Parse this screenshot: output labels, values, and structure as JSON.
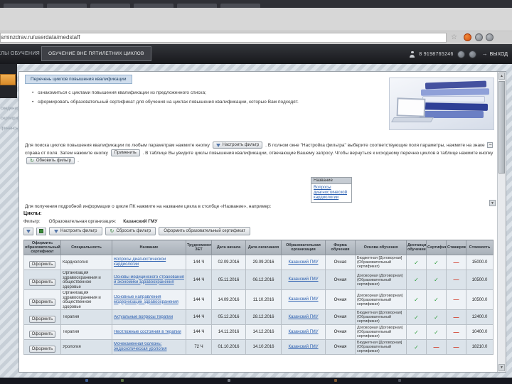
{
  "browser": {
    "url": "rosminzdrav.ru/userdata/medstaff"
  },
  "header": {
    "tab_cycles": "ЦИКЛЫ ОБУЧЕНИЯ",
    "tab_outside_cycles": "ОБУЧЕНИЕ ВНЕ ПЯТИЛЕТНИХ ЦИКЛОВ",
    "phone": "8 9198765246",
    "logout_label": "ВЫХОД"
  },
  "sidebar": {
    "items": [
      {
        "label": "сведения"
      },
      {
        "label": "сертификаты"
      },
      {
        "label": "финансы"
      }
    ]
  },
  "icons": {
    "star": "☆",
    "scroll_down": "▼",
    "scroll_up": "▲",
    "refresh": "↻",
    "logout_arrow": "→",
    "minus": "−"
  },
  "colors": {
    "accent_orange": "#d98a28",
    "link_blue": "#2b5fb0",
    "check_green": "#2e9e3a",
    "dash_red": "#d23c2a"
  },
  "content": {
    "section_title": "Перечень циклов повышения квалификации",
    "bullets": [
      "ознакомиться с циклами повышения квалификации из предложенного списка;",
      "сформировать образовательный сертификат для обучения на циклах повышения квалификации, которые Вам подходят."
    ],
    "para": {
      "seg1": "Для поиска циклов повышения квалификации по любым параметрам нажмите кнопку",
      "btn_configure": "Настроить фильтр",
      "seg2": ". В полном окне \"Настройка фильтра\" выберите соответствующие поля параметры, нажмите на знаке",
      "seg3": "справа от поля. Затем нажмите кнопку",
      "btn_apply": "Применить",
      "seg4": ". В таблице Вы увидите циклы повышения квалификации, отвечающие Вашему запросу. Чтобы вернуться к исходному перечню циклов в таблице нажмите кнопку",
      "btn_refresh": "Обновить фильтр",
      "seg5": "."
    },
    "example": {
      "header": "Название",
      "link": "Вопросы диагностической кардиологии"
    },
    "info_line": "Для получения подробной информации о цикле ПК нажмите на название цикла в столбце «Название», например:"
  },
  "cycles": {
    "title": "Циклы:",
    "filter_label": "Фильтр:",
    "filter_field": "Образовательная организация:",
    "filter_value": "Казанский ГМУ",
    "toolbar": {
      "configure": "Настроить фильтр",
      "reset": "Сбросить фильтр",
      "make_certificate": "Оформить образовательный сертификат"
    },
    "table": {
      "columns": [
        "Оформить образовательный сертификат",
        "Специальность",
        "Название",
        "Трудоемкость ЗЕТ",
        "Дата начала",
        "Дата окончания",
        "Образовательная организация",
        "Форма обучения",
        "Основа обучения",
        "Дистанционное обучение",
        "Сертификат",
        "Стажировка",
        "Стоимость"
      ],
      "make_button": "Оформить",
      "rows": [
        {
          "specialty": "Кардиология",
          "name": "Вопросы диагностической кардиологии",
          "hours": "144 Ч",
          "start": "02.09.2016",
          "end": "29.09.2016",
          "org": "Казанский ГМУ",
          "form": "Очная",
          "basis": "Бюджетная [Договорная] (Образовательный сертификат)",
          "dist": "✓",
          "cert": "✓",
          "stag": "—",
          "cost": "15000.0"
        },
        {
          "specialty": "Организация здравоохранения и общественное здоровье",
          "name": "Основы медицинского страхования и экономики здравоохранения",
          "hours": "144 Ч",
          "start": "05.11.2016",
          "end": "06.12.2016",
          "org": "Казанский ГМУ",
          "form": "Очная",
          "basis": "Договорная [Договорная] (Образовательный сертификат)",
          "dist": "✓",
          "cert": "✓",
          "stag": "—",
          "cost": "10500.0"
        },
        {
          "specialty": "Организация здравоохранения и общественное здоровье",
          "name": "Основные направления модернизации здравоохранения",
          "hours": "144 Ч",
          "start": "14.09.2016",
          "end": "11.10.2016",
          "org": "Казанский ГМУ",
          "form": "Очная",
          "basis": "Договорная [Договорная] (Образовательный сертификат)",
          "dist": "✓",
          "cert": "✓",
          "stag": "—",
          "cost": "10500.0"
        },
        {
          "specialty": "Терапия",
          "name": "Актуальные вопросы терапии",
          "hours": "144 Ч",
          "start": "05.12.2016",
          "end": "28.12.2016",
          "org": "Казанский ГМУ",
          "form": "Очная",
          "basis": "Бюджетная [Договорная] (Образовательный сертификат)",
          "dist": "✓",
          "cert": "✓",
          "stag": "—",
          "cost": "12400.0"
        },
        {
          "specialty": "Терапия",
          "name": "Неотложные состояния в терапии",
          "hours": "144 Ч",
          "start": "14.11.2016",
          "end": "14.12.2016",
          "org": "Казанский ГМУ",
          "form": "Очная",
          "basis": "Договорная [Договорная] (Образовательный сертификат)",
          "dist": "✓",
          "cert": "✓",
          "stag": "—",
          "cost": "10400.0"
        },
        {
          "specialty": "Урология",
          "name": "Мочекаменная болезнь: эндоскопическая урология",
          "hours": "72 Ч",
          "start": "01.10.2016",
          "end": "14.10.2016",
          "org": "Казанский ГМУ",
          "form": "Очная",
          "basis": "Бюджетная [Договорная] (Образовательный сертификат)",
          "dist": "✓",
          "cert": "—",
          "stag": "—",
          "cost": "18210.0"
        }
      ]
    }
  }
}
